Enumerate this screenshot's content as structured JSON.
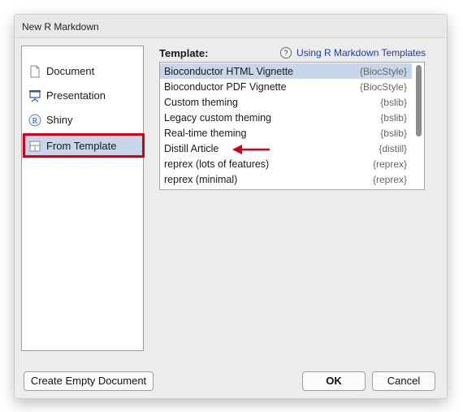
{
  "window": {
    "title": "New R Markdown"
  },
  "sidebar": {
    "items": [
      {
        "label": "Document",
        "icon": "document-icon"
      },
      {
        "label": "Presentation",
        "icon": "presentation-icon"
      },
      {
        "label": "Shiny",
        "icon": "shiny-r-icon"
      },
      {
        "label": "From Template",
        "icon": "template-icon",
        "selected": true
      }
    ]
  },
  "template": {
    "label": "Template:",
    "help_icon": "?",
    "help_link": "Using R Markdown Templates",
    "items": [
      {
        "name": "Bioconductor HTML Vignette",
        "package": "{BiocStyle}",
        "selected": true
      },
      {
        "name": "Bioconductor PDF Vignette",
        "package": "{BiocStyle}"
      },
      {
        "name": "Custom theming",
        "package": "{bslib}"
      },
      {
        "name": "Legacy custom theming",
        "package": "{bslib}"
      },
      {
        "name": "Real-time theming",
        "package": "{bslib}"
      },
      {
        "name": "Distill Article",
        "package": "{distill}"
      },
      {
        "name": "reprex (lots of features)",
        "package": "{reprex}"
      },
      {
        "name": "reprex (minimal)",
        "package": "{reprex}"
      }
    ]
  },
  "buttons": {
    "create_empty": "Create Empty Document",
    "ok": "OK",
    "cancel": "Cancel"
  },
  "colors": {
    "selection": "#c7d6e9",
    "highlight": "#d0021b",
    "link": "#1c3d9a"
  }
}
